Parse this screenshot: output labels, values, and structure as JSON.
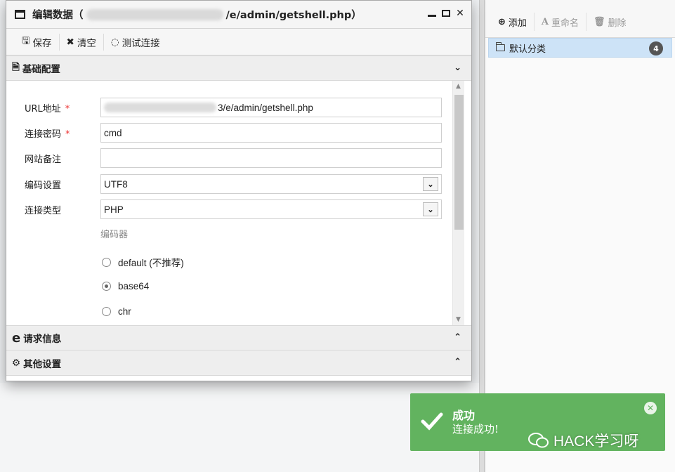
{
  "dialog": {
    "title_prefix": "编辑数据（",
    "title_suffix": "/e/admin/getshell.php）",
    "toolbar": {
      "save_label": "保存",
      "clear_label": "清空",
      "test_label": "测试连接"
    },
    "sections": {
      "basic": "基础配置",
      "request": "请求信息",
      "other": "其他设置"
    },
    "form": {
      "url_label": "URL地址",
      "url_value": "3/e/admin/getshell.php",
      "password_label": "连接密码",
      "password_value": "cmd",
      "note_label": "网站备注",
      "note_value": "",
      "encoding_label": "编码设置",
      "encoding_value": "UTF8",
      "type_label": "连接类型",
      "type_value": "PHP",
      "required_mark": "*",
      "encoder_label": "编码器",
      "encoders": [
        {
          "label": "default (不推荐)",
          "checked": false
        },
        {
          "label": "base64",
          "checked": true
        },
        {
          "label": "chr",
          "checked": false
        }
      ]
    }
  },
  "right_panel": {
    "add_label": "添加",
    "rename_label": "重命名",
    "delete_label": "删除",
    "category_label": "默认分类",
    "category_count": "4"
  },
  "toast": {
    "title": "成功",
    "message": "连接成功!",
    "color": "#62b35f"
  },
  "watermark": "HACK学习呀"
}
